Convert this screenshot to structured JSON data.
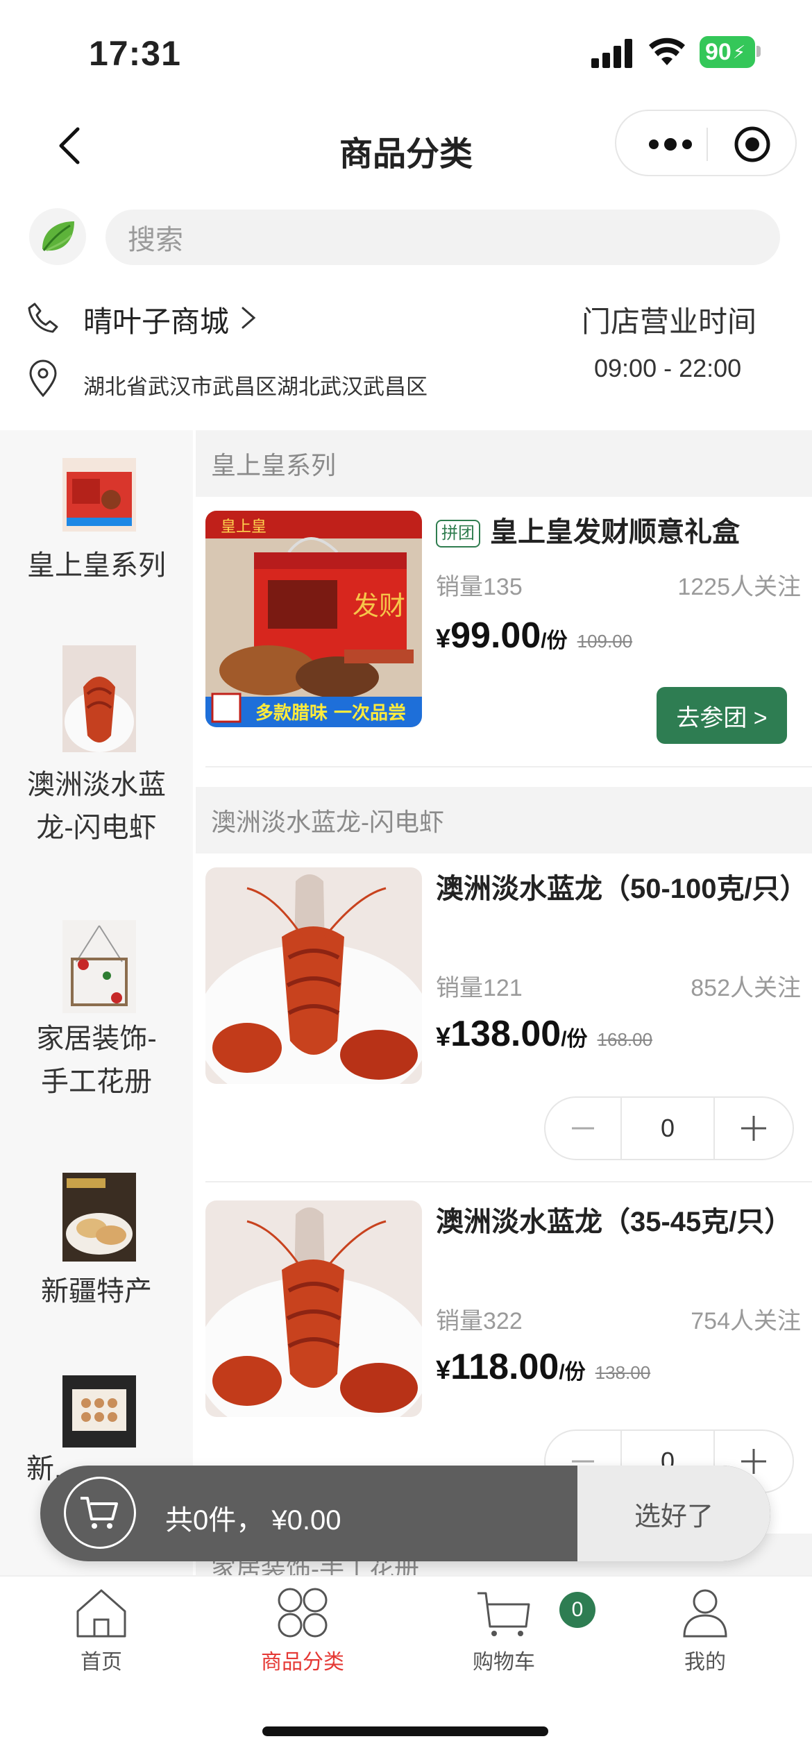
{
  "status": {
    "time": "17:31",
    "battery": "90"
  },
  "nav": {
    "title": "商品分类"
  },
  "search": {
    "placeholder": "搜索"
  },
  "store": {
    "name": "晴叶子商城",
    "address": "湖北省武汉市武昌区湖北武汉武昌区",
    "hours_title": "门店营业时间",
    "hours": "09:00 - 22:00"
  },
  "categories": [
    {
      "label": "皇上皇系列"
    },
    {
      "label": "澳洲淡水蓝龙-闪电虾"
    },
    {
      "label": "家居装饰-手工花册"
    },
    {
      "label": "新疆特产"
    },
    {
      "label": "新..."
    }
  ],
  "sections": [
    {
      "title": "皇上皇系列"
    },
    {
      "title": "澳洲淡水蓝龙-闪电虾"
    },
    {
      "title": "家居装饰-手工花册"
    }
  ],
  "products": [
    {
      "tag": "拼团",
      "title": "皇上皇发财顺意礼盒",
      "sales": "销量135",
      "follow": "1225人关注",
      "currency": "¥",
      "price": "99.00",
      "unit": "/份",
      "orig_price": "109.00",
      "button": "去参团 >",
      "image_banner": "多款腊味 一次品尝",
      "image_brand": "皇上皇"
    },
    {
      "title": "澳洲淡水蓝龙（50-100克/只）",
      "sales": "销量121",
      "follow": "852人关注",
      "currency": "¥",
      "price": "138.00",
      "unit": "/份",
      "orig_price": "168.00",
      "qty": "0"
    },
    {
      "title": "澳洲淡水蓝龙（35-45克/只）",
      "sales": "销量322",
      "follow": "754人关注",
      "currency": "¥",
      "price": "118.00",
      "unit": "/份",
      "orig_price": "138.00",
      "qty": "0"
    }
  ],
  "cart": {
    "summary": "共0件，  ¥0.00",
    "checkout": "选好了"
  },
  "tabs": [
    {
      "label": "首页"
    },
    {
      "label": "商品分类"
    },
    {
      "label": "购物车"
    },
    {
      "label": "我的"
    }
  ],
  "cart_badge": "0",
  "colors": {
    "brand_green": "#2e7d52",
    "active_red": "#e53935",
    "cart_bar": "#5e5e5e"
  }
}
